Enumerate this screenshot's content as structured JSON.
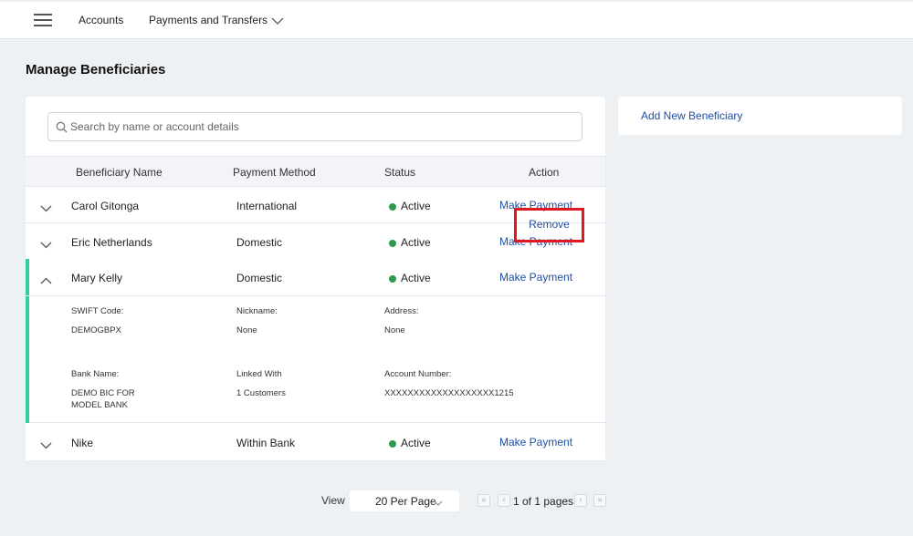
{
  "nav": {
    "accounts": "Accounts",
    "payments": "Payments and Transfers"
  },
  "page": {
    "title": "Manage Beneficiaries"
  },
  "search": {
    "placeholder": "Search by name or account details"
  },
  "table": {
    "headers": [
      "Beneficiary Name",
      "Payment Method",
      "Status",
      "Action"
    ],
    "rows": [
      {
        "name": "Carol Gitonga",
        "method": "International",
        "status": "Active",
        "action": "Make Payment"
      },
      {
        "name": "Eric Netherlands",
        "method": "Domestic",
        "status": "Active",
        "action": "Make Payment"
      },
      {
        "name": "Mary Kelly",
        "method": "Domestic",
        "status": "Active",
        "action": "Make Payment"
      },
      {
        "name": "Nike",
        "method": "Within Bank",
        "status": "Active",
        "action": "Make Payment"
      }
    ]
  },
  "details": {
    "swift_label": "SWIFT Code:",
    "swift_value": "DEMOGBPX",
    "nickname_label": "Nickname:",
    "nickname_value": "None",
    "address_label": "Address:",
    "address_value": "None",
    "bank_label": "Bank Name:",
    "bank_value_line1": "DEMO BIC FOR",
    "bank_value_line2": "MODEL BANK",
    "linked_label": "Linked With",
    "linked_value": "1 Customers",
    "account_label": "Account Number:",
    "account_value": "XXXXXXXXXXXXXXXXXXX1215",
    "remove": "Remove"
  },
  "side": {
    "add_new": "Add New Beneficiary"
  },
  "pager": {
    "view_label": "View",
    "per_page": "20 Per Page",
    "page_text": "1 of 1 pages"
  },
  "colors": {
    "status_active": "#2e9a4e",
    "link": "#1f4fa3",
    "accent": "#2fd09b",
    "highlight": "#e01820"
  },
  "icons": {
    "menu": "hamburger-icon",
    "dropdown": "chevron-down-icon",
    "search": "search-icon",
    "expand": "chevron-down-icon",
    "collapse": "chevron-up-icon",
    "first": "double-chevron-left-icon",
    "prev": "chevron-left-icon",
    "next": "chevron-right-icon",
    "last": "double-chevron-right-icon"
  }
}
